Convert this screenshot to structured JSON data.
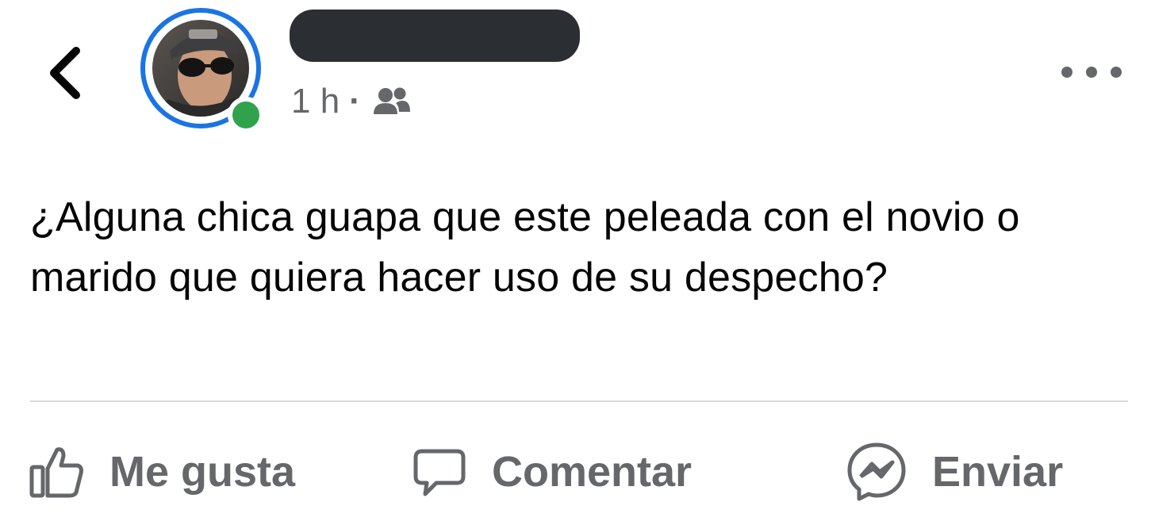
{
  "header": {
    "author_name_redacted": true,
    "timestamp": "1 h",
    "separator": "·",
    "audience_icon": "friends-icon",
    "back_icon": "chevron-left-icon",
    "more_icon": "more-dots-icon"
  },
  "post": {
    "text": "¿Alguna chica guapa que este peleada con el novio o marido que quiera hacer uso de su despecho?"
  },
  "actions": {
    "like_label": "Me gusta",
    "comment_label": "Comentar",
    "send_label": "Enviar"
  },
  "colors": {
    "ring": "#1b74e4",
    "online": "#31a24c",
    "secondary_text": "#65676b",
    "primary_text": "#050505"
  }
}
